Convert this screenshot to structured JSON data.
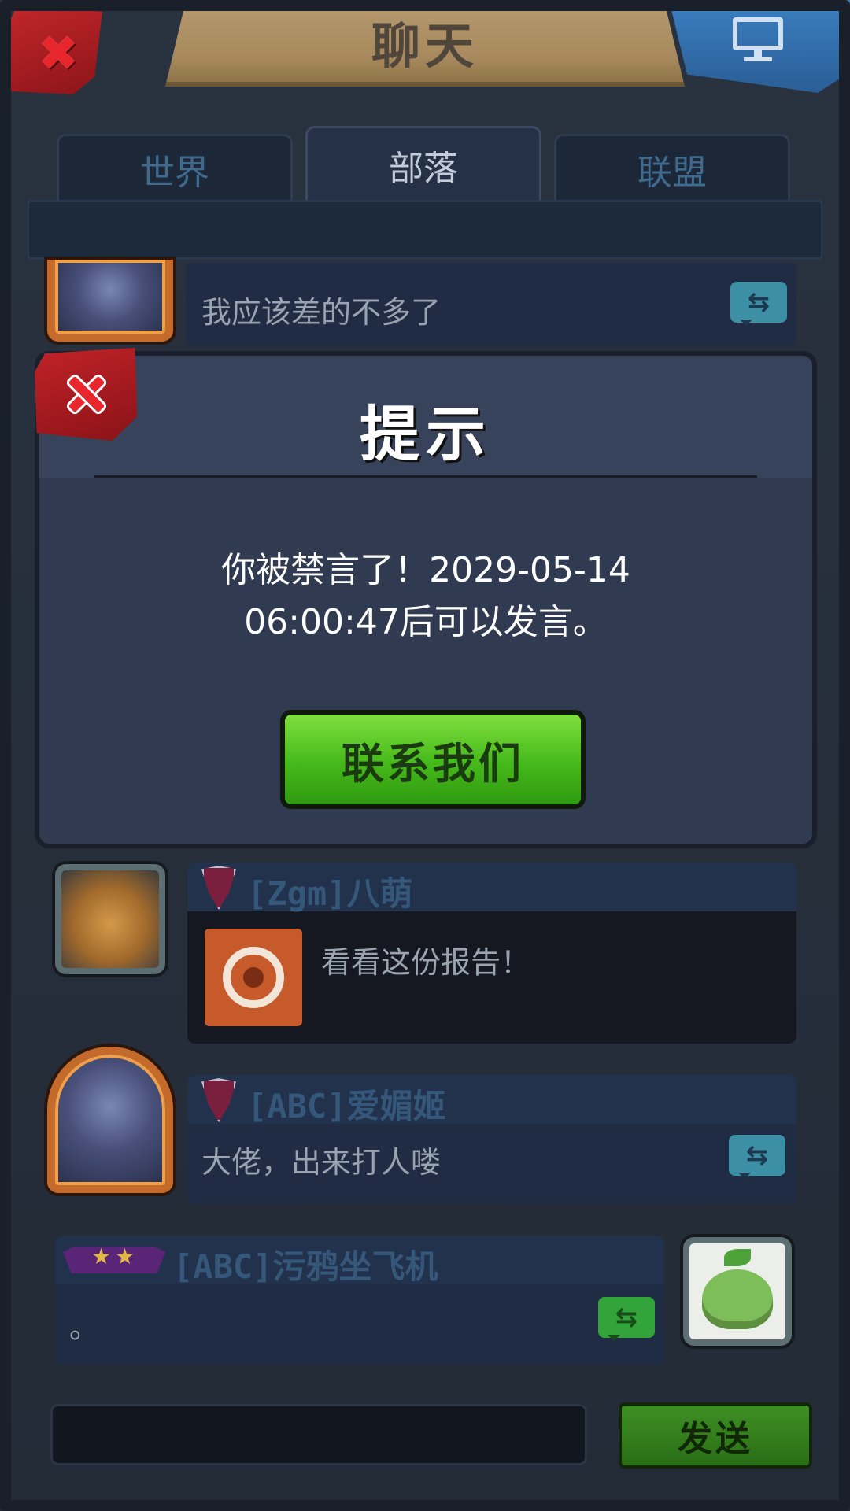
{
  "header": {
    "title": "聊天",
    "close_icon": "close-icon",
    "screen_icon": "monitor-icon"
  },
  "tabs": [
    {
      "label": "世界"
    },
    {
      "label": "部落"
    },
    {
      "label": "联盟"
    }
  ],
  "active_tab": "部落",
  "messages": [
    {
      "text": "我应该差的不多了"
    },
    {
      "tag": "[Zgm]",
      "name": "八萌",
      "text": "看看这份报告！"
    },
    {
      "tag": "[ABC]",
      "name": "爱媚姬",
      "text": "大佬，出来打人喽"
    },
    {
      "tag": "[ABC]",
      "name": "污鸦坐飞机",
      "text": "。"
    }
  ],
  "dialog": {
    "title": "提示",
    "message_line1": "你被禁言了！2029-05-14",
    "message_line2": "06:00:47后可以发言。",
    "button_label": "联系我们"
  },
  "input": {
    "send_label": "发送",
    "placeholder": ""
  },
  "colors": {
    "accent_green": "#45b91a",
    "close_red": "#c2272b",
    "title_parchment": "#b69970"
  }
}
